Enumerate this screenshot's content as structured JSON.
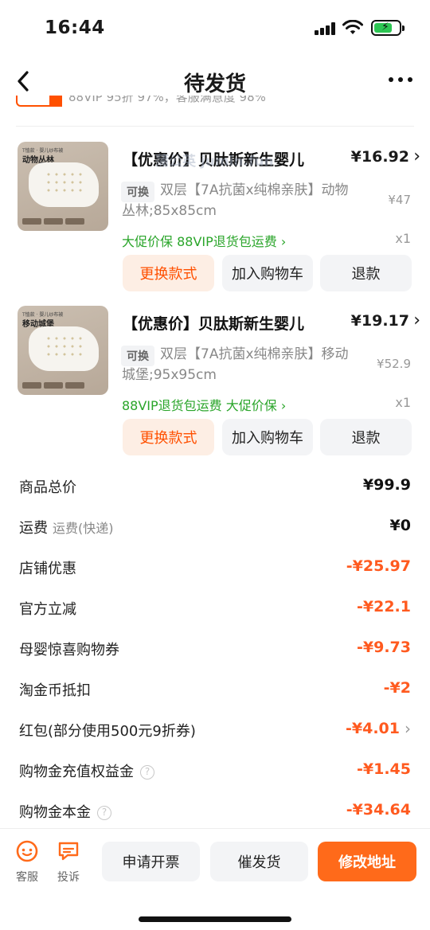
{
  "status": {
    "time": "16:44"
  },
  "nav": {
    "title": "待发货"
  },
  "clipped_banner": {
    "text": "88VIP 95折 97%，客服满意度 98%"
  },
  "watermark": "蒲公英 jumin.fun",
  "products": [
    {
      "thumb_caption_small": "T恤款 · 婴儿纱布被",
      "thumb_caption": "动物丛林",
      "name": "【优惠价】贝肽斯新生婴儿",
      "price": "¥16.92",
      "swap_tag": "可换",
      "spec": "双层【7A抗菌x纯棉亲肤】动物丛林;85x85cm",
      "original_price": "¥47",
      "promo": "大促价保  88VIP退货包运费 ›",
      "qty": "x1",
      "buttons": [
        "更换款式",
        "加入购物车",
        "退款"
      ]
    },
    {
      "thumb_caption_small": "T恤款 · 婴儿纱布被",
      "thumb_caption": "移动城堡",
      "name": "【优惠价】贝肽斯新生婴儿",
      "price": "¥19.17",
      "swap_tag": "可换",
      "spec": "双层【7A抗菌x纯棉亲肤】移动城堡;95x95cm",
      "original_price": "¥52.9",
      "promo": "88VIP退货包运费  大促价保 ›",
      "qty": "x1",
      "buttons": [
        "更换款式",
        "加入购物车",
        "退款"
      ]
    }
  ],
  "summary": [
    {
      "label": "商品总价",
      "value": "¥99.9"
    },
    {
      "label": "运费",
      "sub": "运费(快递)",
      "value": "¥0"
    },
    {
      "label": "店铺优惠",
      "value": "-¥25.97"
    },
    {
      "label": "官方立减",
      "value": "-¥22.1"
    },
    {
      "label": "母婴惊喜购物券",
      "value": "-¥9.73"
    },
    {
      "label": "淘金币抵扣",
      "value": "-¥2"
    },
    {
      "label": "红包(部分使用500元9折券)",
      "value": "-¥4.01"
    },
    {
      "label": "购物金充值权益金",
      "value": "-¥1.45"
    },
    {
      "label": "购物金本金",
      "value": "-¥34.64"
    }
  ],
  "bottom": {
    "service_label": "客服",
    "complain_label": "投诉",
    "invoice_label": "申请开票",
    "urge_label": "催发货",
    "address_label": "修改地址"
  },
  "colors": {
    "accent": "#ff5000",
    "discount": "#ff5a1f",
    "promo_green": "#2aa52a"
  },
  "icons": [
    "back-arrow-icon",
    "more-dots-icon",
    "signal-icon",
    "wifi-icon",
    "battery-icon",
    "service-face-icon",
    "complain-chat-icon",
    "help-icon",
    "chevron-right-icon"
  ]
}
